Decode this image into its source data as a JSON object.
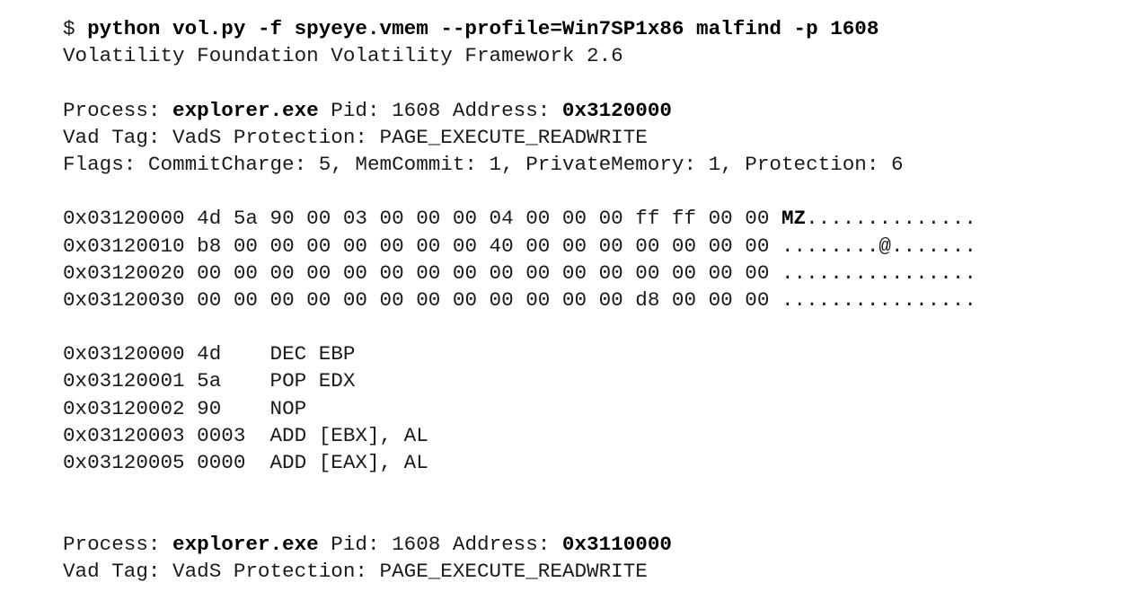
{
  "command": {
    "prompt": "$",
    "text": "python vol.py -f spyeye.vmem --profile=Win7SP1x86 malfind -p 1608"
  },
  "banner": "Volatility Foundation Volatility Framework 2.6",
  "block1": {
    "label_process": "Process:",
    "process": "explorer.exe",
    "label_pid": "Pid:",
    "pid": "1608",
    "label_address": "Address:",
    "address": "0x3120000",
    "vad_line": "Vad Tag: VadS Protection: PAGE_EXECUTE_READWRITE",
    "flags_line": "Flags: CommitCharge: 5, MemCommit: 1, PrivateMemory: 1, Protection: 6"
  },
  "hexdump": [
    {
      "addr": "0x03120000",
      "bytes": "4d 5a 90 00 03 00 00 00 04 00 00 00 ff ff 00 00",
      "ascii_bold": "MZ",
      "ascii": ".............."
    },
    {
      "addr": "0x03120010",
      "bytes": "b8 00 00 00 00 00 00 00 40 00 00 00 00 00 00 00",
      "ascii_bold": "",
      "ascii": "........@......."
    },
    {
      "addr": "0x03120020",
      "bytes": "00 00 00 00 00 00 00 00 00 00 00 00 00 00 00 00",
      "ascii_bold": "",
      "ascii": "................"
    },
    {
      "addr": "0x03120030",
      "bytes": "00 00 00 00 00 00 00 00 00 00 00 00 d8 00 00 00",
      "ascii_bold": "",
      "ascii": "................"
    }
  ],
  "disasm": [
    {
      "addr": "0x03120000",
      "bytes": "4d",
      "instr": "DEC EBP"
    },
    {
      "addr": "0x03120001",
      "bytes": "5a",
      "instr": "POP EDX"
    },
    {
      "addr": "0x03120002",
      "bytes": "90",
      "instr": "NOP"
    },
    {
      "addr": "0x03120003",
      "bytes": "0003",
      "instr": "ADD [EBX], AL"
    },
    {
      "addr": "0x03120005",
      "bytes": "0000",
      "instr": "ADD [EAX], AL"
    }
  ],
  "block2": {
    "label_process": "Process:",
    "process": "explorer.exe",
    "label_pid": "Pid:",
    "pid": "1608",
    "label_address": "Address:",
    "address": "0x3110000",
    "vad_line": "Vad Tag: VadS Protection: PAGE_EXECUTE_READWRITE"
  }
}
